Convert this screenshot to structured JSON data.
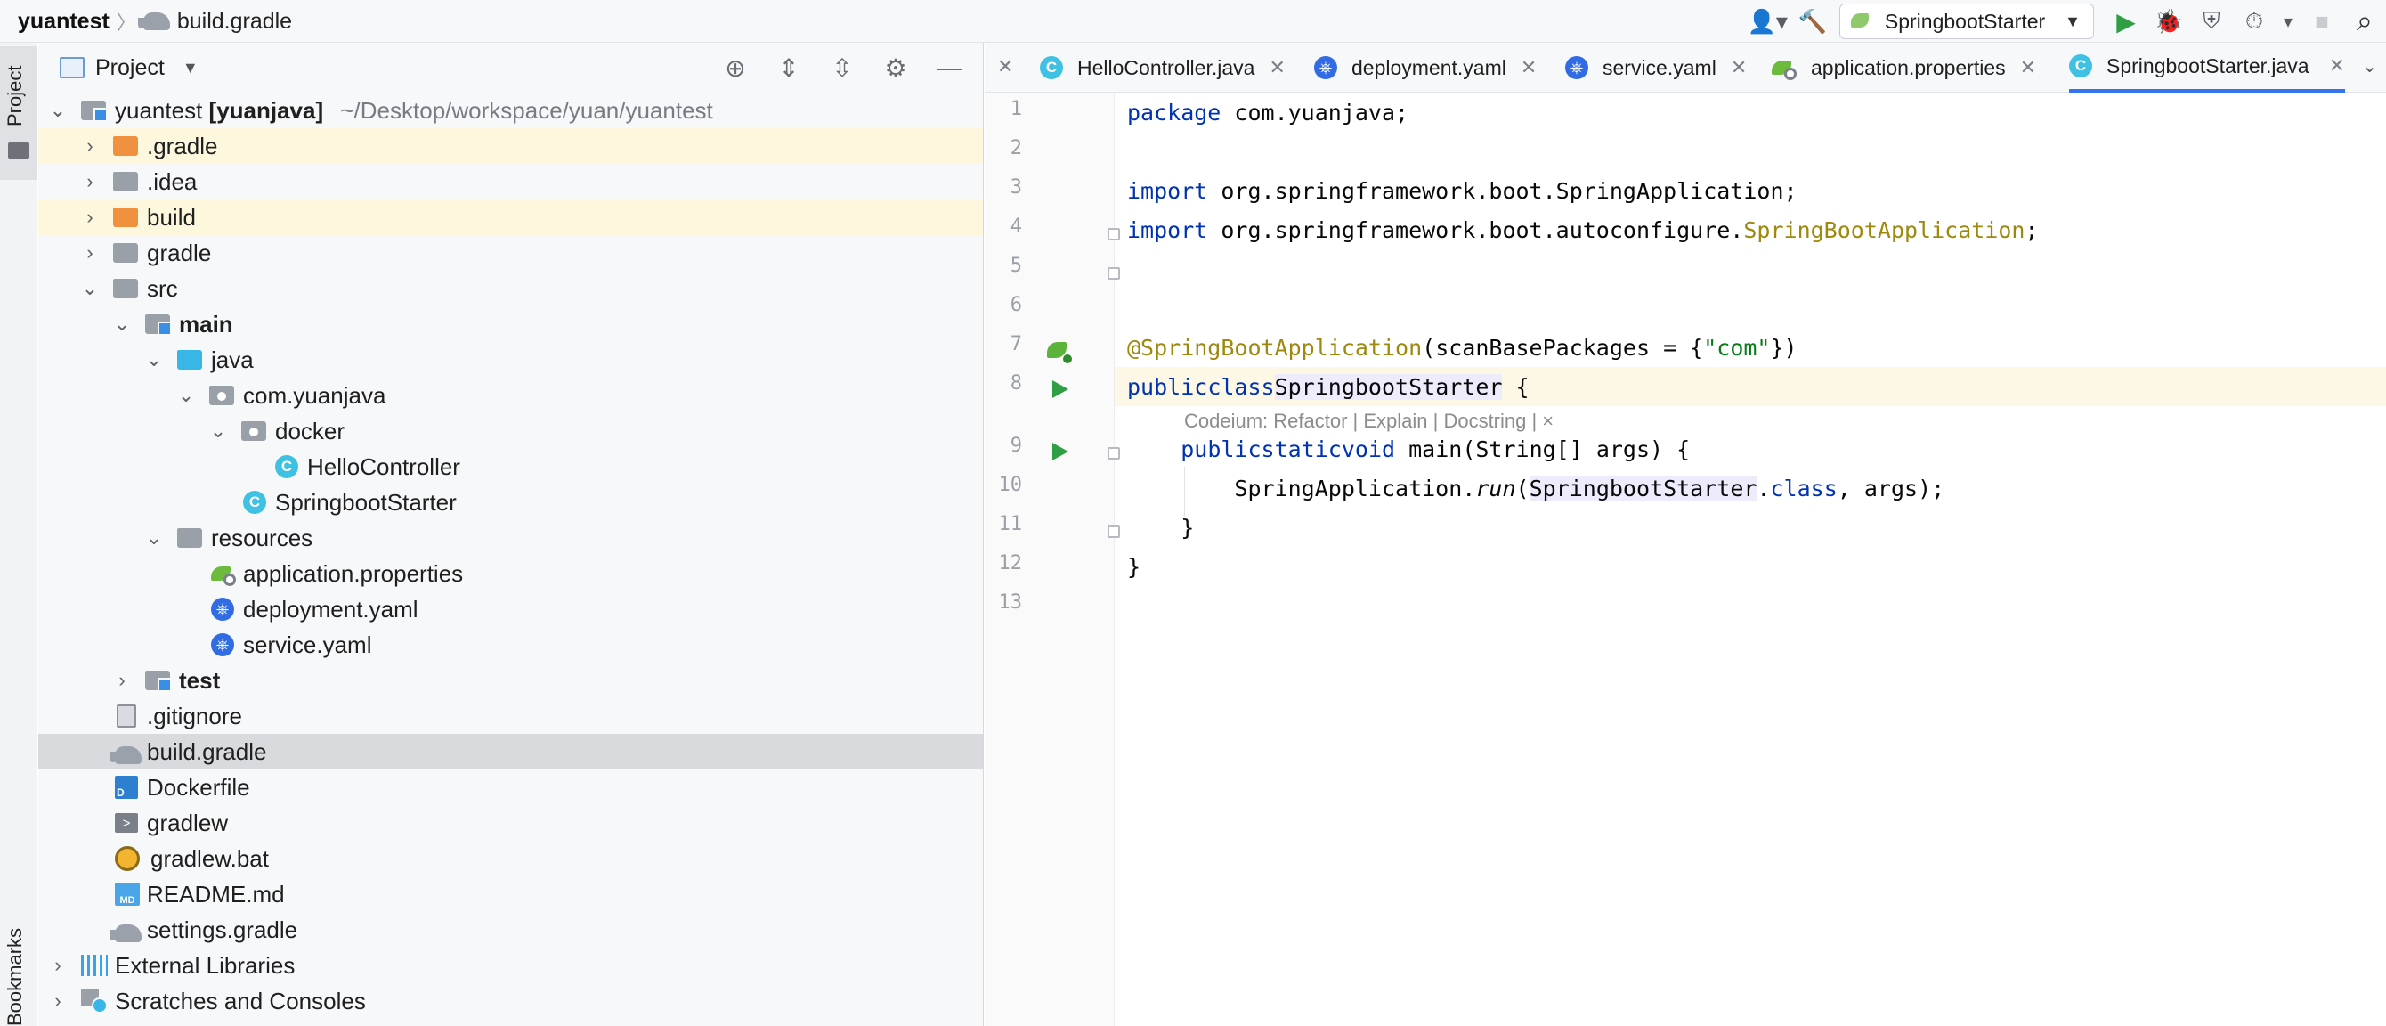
{
  "breadcrumb": {
    "project": "yuantest",
    "separator": "〉",
    "file": "build.gradle"
  },
  "toolbar": {
    "run_config": "SpringbootStarter",
    "run_config_caret": "▼",
    "user_icon": "👤▾",
    "build_icon": "🔨",
    "run_icon": "▶",
    "debug_icon": "🐞",
    "coverage_icon": "⛨",
    "profile_icon": "⏱",
    "more_caret": "▾",
    "stop_icon": "■",
    "search_icon": "⌕"
  },
  "stripe": {
    "project_label": "Project",
    "bookmarks_label": "Bookmarks"
  },
  "panel": {
    "title": "Project",
    "caret": "▼",
    "tools": {
      "locate": "⊕",
      "expand": "⇕",
      "collapse": "⇳",
      "settings": "⚙",
      "hide": "—"
    }
  },
  "tree": [
    {
      "label": "yuantest",
      "bold_suffix": "[yuanjava]",
      "path": "~/Desktop/workspace/yuan/yuantest",
      "chev": "⌄"
    },
    {
      "label": ".gradle",
      "chev": "›"
    },
    {
      "label": ".idea",
      "chev": "›"
    },
    {
      "label": "build",
      "chev": "›"
    },
    {
      "label": "gradle",
      "chev": "›"
    },
    {
      "label": "src",
      "chev": "⌄"
    },
    {
      "label": "main",
      "chev": "⌄"
    },
    {
      "label": "java",
      "chev": "⌄"
    },
    {
      "label": "com.yuanjava",
      "chev": "⌄"
    },
    {
      "label": "docker",
      "chev": "⌄"
    },
    {
      "label": "HelloController",
      "icon_text": "C"
    },
    {
      "label": "SpringbootStarter",
      "icon_text": "C"
    },
    {
      "label": "resources",
      "chev": "⌄"
    },
    {
      "label": "application.properties"
    },
    {
      "label": "deployment.yaml",
      "icon_text": "⎈"
    },
    {
      "label": "service.yaml",
      "icon_text": "⎈"
    },
    {
      "label": "test",
      "chev": "›"
    },
    {
      "label": ".gitignore"
    },
    {
      "label": "build.gradle"
    },
    {
      "label": "Dockerfile",
      "icon_text": "D"
    },
    {
      "label": "gradlew",
      "icon_text": ">"
    },
    {
      "label": "gradlew.bat"
    },
    {
      "label": "README.md",
      "icon_text": "MD"
    },
    {
      "label": "settings.gradle"
    },
    {
      "label": "External Libraries",
      "chev": "›"
    },
    {
      "label": "Scratches and Consoles",
      "chev": "›"
    }
  ],
  "tabs": [
    {
      "label": "HelloController.java",
      "icon_text": "C",
      "close": "✕"
    },
    {
      "label": "deployment.yaml",
      "icon_text": "⎈",
      "close": "✕"
    },
    {
      "label": "service.yaml",
      "icon_text": "⎈",
      "close": "✕"
    },
    {
      "label": "application.properties",
      "close": "✕"
    },
    {
      "label": "SpringbootStarter.java",
      "icon_text": "C",
      "close": "✕"
    }
  ],
  "tabs_close_first": "✕",
  "tabs_more": "⌄",
  "editor": {
    "line_numbers": [
      "1",
      "2",
      "3",
      "4",
      "5",
      "6",
      "7",
      "8",
      "9",
      "10",
      "11",
      "12",
      "13"
    ],
    "code": {
      "l1_kw": "package",
      "l1_rest": " com.yuanjava;",
      "l3_kw": "import",
      "l3_rest": " org.springframework.boot.SpringApplication;",
      "l4_kw": "import",
      "l4_rest": " org.springframework.boot.autoconfigure.",
      "l4_ann": "SpringBootApplication",
      "l4_end": ";",
      "l7_ann": "@SpringBootApplication",
      "l7_a": "(scanBasePackages = {",
      "l7_str": "\"com\"",
      "l7_b": "})",
      "l8_kw1": "public",
      "l8_kw2": "class",
      "l8_cls": "SpringbootStarter",
      "l8_end": " {",
      "hint": "Codeium: Refactor | Explain | Docstring | ×",
      "l9_indent": "    ",
      "l9_kw1": "public",
      "l9_kw2": "static",
      "l9_kw3": "void",
      "l9_rest": " main(String[] args) {",
      "l10_a": "        SpringApplication.",
      "l10_run": "run",
      "l10_b": "(",
      "l10_cls": "SpringbootStarter",
      "l10_dot": ".",
      "l10_kw": "class",
      "l10_c": ", args);",
      "l11": "    }",
      "l12": "}"
    }
  }
}
